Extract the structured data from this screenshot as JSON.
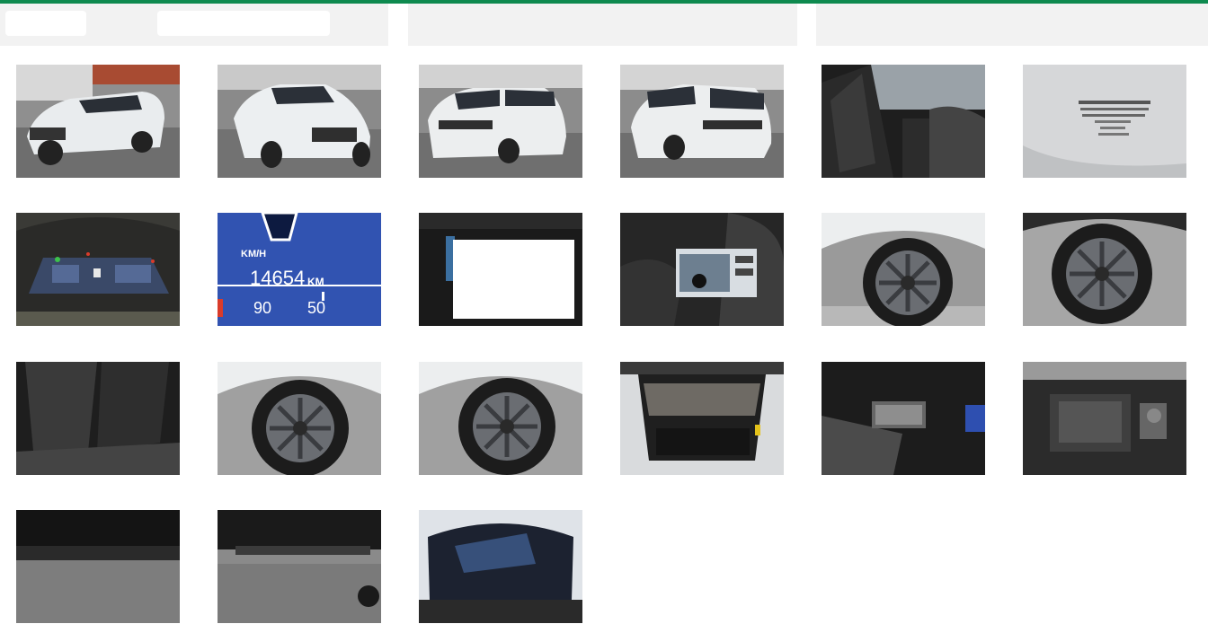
{
  "colors": {
    "accent": "#0e8a4f",
    "panel": "#f2f2f2"
  },
  "gallery": {
    "photos": [
      {
        "subject": "front-left exterior"
      },
      {
        "subject": "front-right exterior"
      },
      {
        "subject": "rear-left exterior"
      },
      {
        "subject": "rear-right exterior"
      },
      {
        "subject": "front seats interior"
      },
      {
        "subject": "vin label"
      },
      {
        "subject": "instrument cluster"
      },
      {
        "subject": "odometer"
      },
      {
        "subject": "infotainment screen (covered)"
      },
      {
        "subject": "keys and registration"
      },
      {
        "subject": "front-left wheel"
      },
      {
        "subject": "front-right wheel"
      },
      {
        "subject": "rear seats"
      },
      {
        "subject": "rear-left wheel"
      },
      {
        "subject": "rear-right wheel"
      },
      {
        "subject": "trunk"
      },
      {
        "subject": "spare wheel well"
      },
      {
        "subject": "engine bay"
      },
      {
        "subject": "underbody front"
      },
      {
        "subject": "underbody rear"
      },
      {
        "subject": "panoramic roof"
      }
    ]
  },
  "odometer": {
    "unit_speed": "KM/H",
    "mileage": "14654",
    "unit_distance": "KM",
    "speed_left": "90",
    "speed_right": "50"
  }
}
